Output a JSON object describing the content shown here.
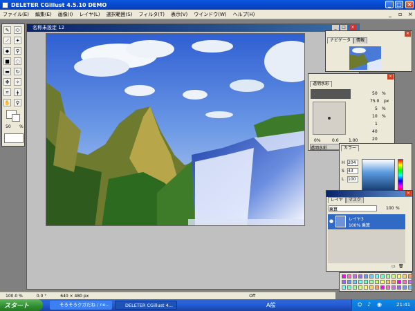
{
  "app": {
    "title": "DELETER CGillust 4.5.10 DEMO"
  },
  "menu": [
    "ファイル(E)",
    "編集(E)",
    "画像(I)",
    "レイヤ(L)",
    "選択範囲(S)",
    "フィルタ(T)",
    "表示(V)",
    "ウインドウ(W)",
    "ヘルプ(H)"
  ],
  "document": {
    "title": "名称未設定 12"
  },
  "tools": {
    "size_value": "50",
    "size_unit": "%"
  },
  "navigator": {
    "tab1": "ナビゲータ",
    "tab2": "情報"
  },
  "brush_palette": {
    "tab": "透明水彩",
    "opacity": "50",
    "opacity_unit": "%",
    "width": "75.0",
    "width_unit": "px",
    "density": "5",
    "density_unit": "%",
    "v4": "10",
    "v4_unit": "%",
    "v5": "1",
    "v6": "40",
    "v7": "20",
    "bottom_left": "0%",
    "bottom_mid": "0.0",
    "bottom_right": "1.00",
    "footer_tab": "透明水彩"
  },
  "color_palette": {
    "tab": "カラー",
    "h_label": "H",
    "h_value": "204",
    "s_label": "S",
    "s_value": "43",
    "l_label": "L",
    "l_value": "100"
  },
  "layers_palette": {
    "tab1": "レイヤ",
    "tab2": "マスク",
    "blend_mode": "乗算",
    "opacity": "100",
    "opacity_unit": "%",
    "layer_name": "レイヤ3",
    "layer_info": "100% 乗算"
  },
  "status": {
    "zoom": "100.0 %",
    "angle": "0.0 °",
    "size": "640 × 480 px",
    "mode": "Off"
  },
  "taskbar": {
    "start": "スタート",
    "task1": "そろそろクガだね / ne...",
    "task2": "DELETER CGillust 4...",
    "tray_ime": "A般",
    "tray_time": "21:41"
  },
  "colors": {
    "title_blue": "#0a58e0",
    "chrome": "#ece9d8",
    "workspace": "#808080",
    "canvas_sky": "#3f6fd6",
    "selected_layer": "#316ac5"
  }
}
